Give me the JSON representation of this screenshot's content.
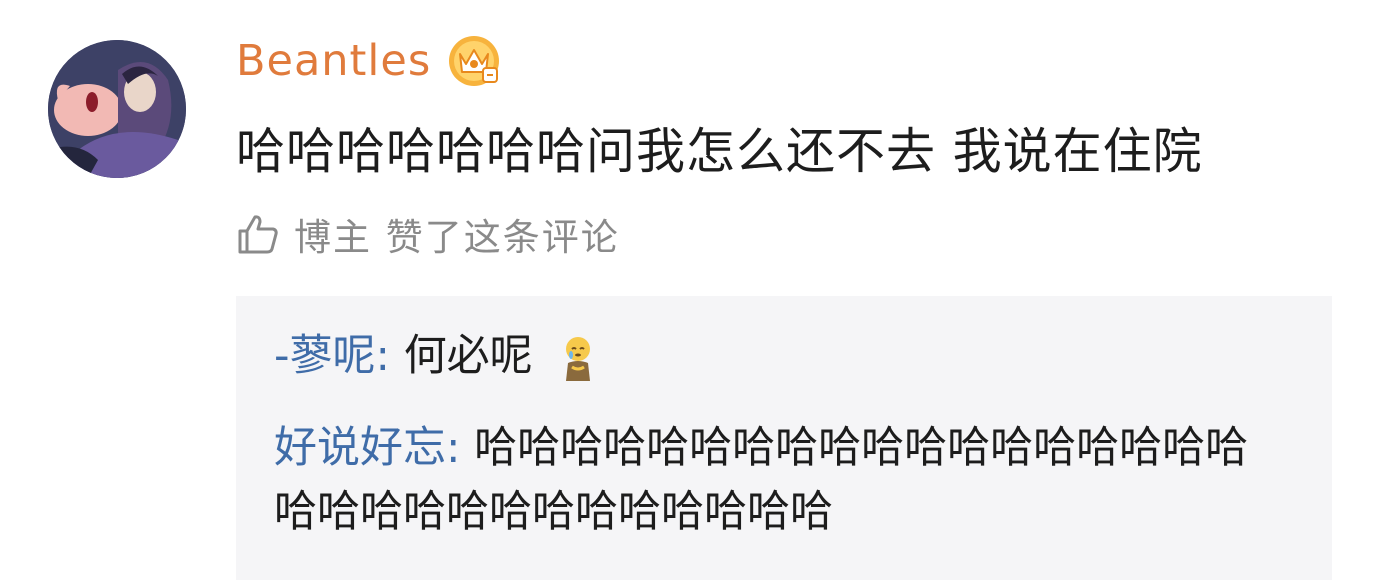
{
  "comment": {
    "username": "Beantles",
    "text": "哈哈哈哈哈哈哈问我怎么还不去 我说在住院",
    "like_text": "博主 赞了这条评论",
    "username_color": "#e07b3c"
  },
  "replies": [
    {
      "name": "-蓼呢:",
      "text": "何必呢",
      "emoji": "crying-emoji",
      "name_color": "#3f6ca8"
    },
    {
      "name": "好说好忘:",
      "text": "哈哈哈哈哈哈哈哈哈哈哈哈哈哈哈哈哈哈哈哈哈哈哈哈哈哈哈哈哈哈哈",
      "name_color": "#3f6ca8"
    }
  ],
  "icons": {
    "vip": "crown-vip-icon",
    "like": "thumbs-up-icon"
  }
}
